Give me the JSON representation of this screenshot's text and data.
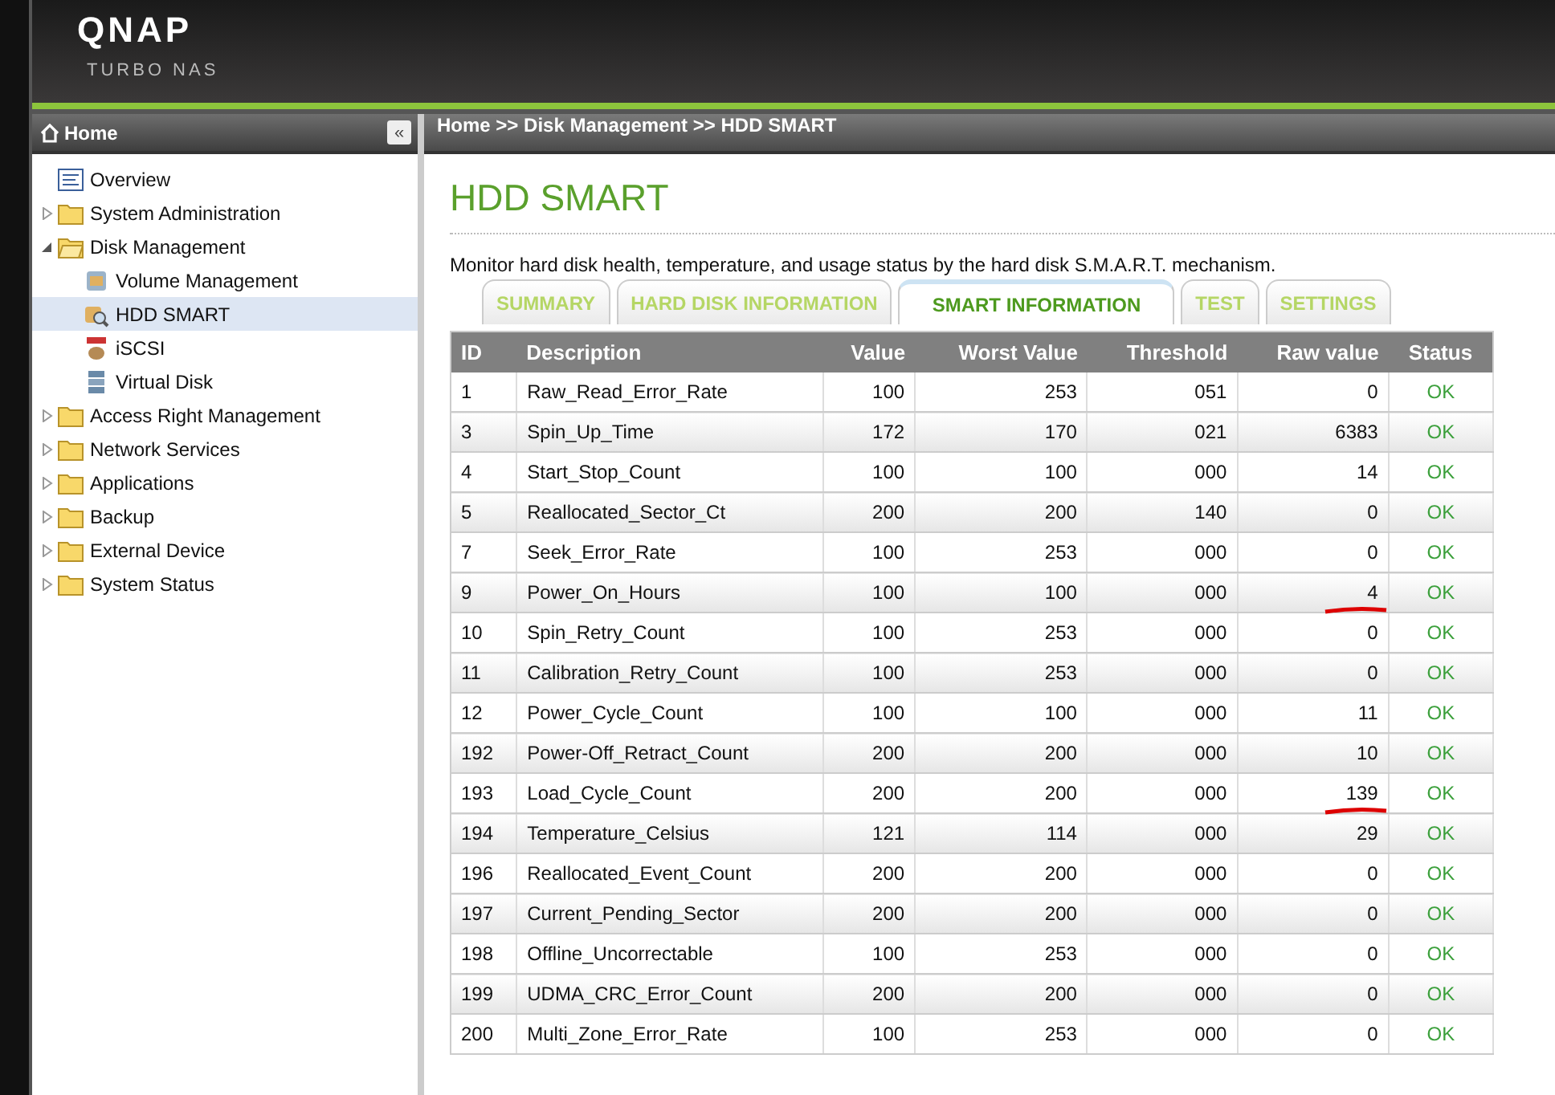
{
  "header": {
    "logo": "QNAP",
    "product": "TURBO NAS"
  },
  "sidebar": {
    "title": "Home",
    "collapse": "«",
    "items": [
      {
        "label": "Overview",
        "kind": "overview",
        "selected": false
      },
      {
        "label": "System Administration",
        "kind": "folder",
        "expanded": false,
        "selected": false
      },
      {
        "label": "Disk Management",
        "kind": "folder",
        "expanded": true,
        "selected": false,
        "children": [
          {
            "label": "Volume Management",
            "kind": "volume",
            "selected": false
          },
          {
            "label": "HDD SMART",
            "kind": "smart",
            "selected": true
          },
          {
            "label": "iSCSI",
            "kind": "iscsi",
            "selected": false
          },
          {
            "label": "Virtual Disk",
            "kind": "vdisk",
            "selected": false
          }
        ]
      },
      {
        "label": "Access Right Management",
        "kind": "folder",
        "expanded": false,
        "selected": false
      },
      {
        "label": "Network Services",
        "kind": "folder",
        "expanded": false,
        "selected": false
      },
      {
        "label": "Applications",
        "kind": "folder",
        "expanded": false,
        "selected": false
      },
      {
        "label": "Backup",
        "kind": "folder",
        "expanded": false,
        "selected": false
      },
      {
        "label": "External Device",
        "kind": "folder",
        "expanded": false,
        "selected": false
      },
      {
        "label": "System Status",
        "kind": "folder",
        "expanded": false,
        "selected": false
      }
    ]
  },
  "breadcrumb": "Home >> Disk Management >> HDD SMART",
  "page": {
    "title": "HDD SMART",
    "description": "Monitor hard disk health, temperature, and usage status by the hard disk S.M.A.R.T. mechanism."
  },
  "tabs": [
    {
      "label": "SUMMARY",
      "selected": false
    },
    {
      "label": "HARD DISK INFORMATION",
      "selected": false
    },
    {
      "label": "SMART INFORMATION",
      "selected": true
    },
    {
      "label": "TEST",
      "selected": false
    },
    {
      "label": "SETTINGS",
      "selected": false
    }
  ],
  "table": {
    "columns": [
      "ID",
      "Description",
      "Value",
      "Worst Value",
      "Threshold",
      "Raw value",
      "Status"
    ],
    "rows": [
      {
        "cells": [
          "1",
          "Raw_Read_Error_Rate",
          "100",
          "253",
          "051",
          "0",
          "OK"
        ],
        "marked": false
      },
      {
        "cells": [
          "3",
          "Spin_Up_Time",
          "172",
          "170",
          "021",
          "6383",
          "OK"
        ],
        "marked": false
      },
      {
        "cells": [
          "4",
          "Start_Stop_Count",
          "100",
          "100",
          "000",
          "14",
          "OK"
        ],
        "marked": false
      },
      {
        "cells": [
          "5",
          "Reallocated_Sector_Ct",
          "200",
          "200",
          "140",
          "0",
          "OK"
        ],
        "marked": false
      },
      {
        "cells": [
          "7",
          "Seek_Error_Rate",
          "100",
          "253",
          "000",
          "0",
          "OK"
        ],
        "marked": false
      },
      {
        "cells": [
          "9",
          "Power_On_Hours",
          "100",
          "100",
          "000",
          "4",
          "OK"
        ],
        "marked": true
      },
      {
        "cells": [
          "10",
          "Spin_Retry_Count",
          "100",
          "253",
          "000",
          "0",
          "OK"
        ],
        "marked": false
      },
      {
        "cells": [
          "11",
          "Calibration_Retry_Count",
          "100",
          "253",
          "000",
          "0",
          "OK"
        ],
        "marked": false
      },
      {
        "cells": [
          "12",
          "Power_Cycle_Count",
          "100",
          "100",
          "000",
          "11",
          "OK"
        ],
        "marked": false
      },
      {
        "cells": [
          "192",
          "Power-Off_Retract_Count",
          "200",
          "200",
          "000",
          "10",
          "OK"
        ],
        "marked": false
      },
      {
        "cells": [
          "193",
          "Load_Cycle_Count",
          "200",
          "200",
          "000",
          "139",
          "OK"
        ],
        "marked": true
      },
      {
        "cells": [
          "194",
          "Temperature_Celsius",
          "121",
          "114",
          "000",
          "29",
          "OK"
        ],
        "marked": false
      },
      {
        "cells": [
          "196",
          "Reallocated_Event_Count",
          "200",
          "200",
          "000",
          "0",
          "OK"
        ],
        "marked": false
      },
      {
        "cells": [
          "197",
          "Current_Pending_Sector",
          "200",
          "200",
          "000",
          "0",
          "OK"
        ],
        "marked": false
      },
      {
        "cells": [
          "198",
          "Offline_Uncorrectable",
          "100",
          "253",
          "000",
          "0",
          "OK"
        ],
        "marked": false
      },
      {
        "cells": [
          "199",
          "UDMA_CRC_Error_Count",
          "200",
          "200",
          "000",
          "0",
          "OK"
        ],
        "marked": false
      },
      {
        "cells": [
          "200",
          "Multi_Zone_Error_Rate",
          "100",
          "253",
          "000",
          "0",
          "OK"
        ],
        "marked": false
      }
    ]
  }
}
